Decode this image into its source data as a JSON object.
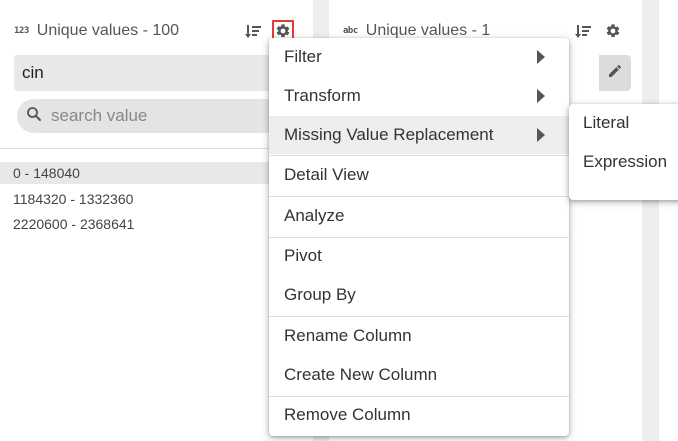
{
  "columns": [
    {
      "type_badge": "123",
      "header": "Unique values - 100",
      "name_value": "cin",
      "search_placeholder": "search value",
      "values": [
        "0 - 148040",
        "1184320 - 1332360",
        "2220600 - 2368641"
      ]
    },
    {
      "type_badge": "abc",
      "header": "Unique values - 1"
    }
  ],
  "menu": {
    "items": [
      {
        "label": "Filter",
        "has_submenu": true
      },
      {
        "label": "Transform",
        "has_submenu": true
      },
      {
        "label": "Missing Value Replacement",
        "has_submenu": true,
        "active": true
      },
      {
        "label": "Detail View"
      },
      {
        "label": "Analyze"
      },
      {
        "label": "Pivot"
      },
      {
        "label": "Group By"
      },
      {
        "label": "Rename Column"
      },
      {
        "label": "Create New Column"
      },
      {
        "label": "Remove Column"
      }
    ]
  },
  "submenu": {
    "items": [
      {
        "label": "Literal"
      },
      {
        "label": "Expression"
      }
    ]
  },
  "colors": {
    "highlight_border": "#e53935",
    "menu_active_bg": "#eeeeee",
    "field_bg": "#e8e8e8"
  },
  "icons": {
    "sort": "sort-icon",
    "gear": "gear-icon",
    "search": "search-icon",
    "edit": "pencil-icon",
    "submenu": "chevron-right-icon"
  }
}
